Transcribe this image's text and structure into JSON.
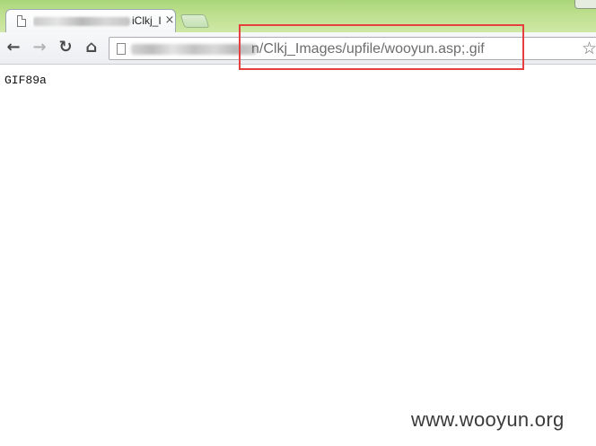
{
  "tab": {
    "title": "iClkj_I",
    "close_glyph": "×"
  },
  "toolbar": {
    "back_glyph": "←",
    "forward_glyph": "→",
    "reload_glyph": "↻",
    "home_glyph": "⌂"
  },
  "address_bar": {
    "url_visible": "n/Clkj_Images/upfile/wooyun.asp;.gif",
    "star_glyph": "☆"
  },
  "page": {
    "body_text": "GIF89a"
  },
  "watermark": {
    "text": "www.wooyun.org"
  },
  "icons": [
    "page-icon",
    "close-icon",
    "back-arrow-icon",
    "forward-arrow-icon",
    "reload-icon",
    "home-icon",
    "star-icon"
  ],
  "colors": {
    "titlebar": "#bfe08f",
    "highlight": "#e5403f",
    "url_text": "#6d6d6d"
  }
}
